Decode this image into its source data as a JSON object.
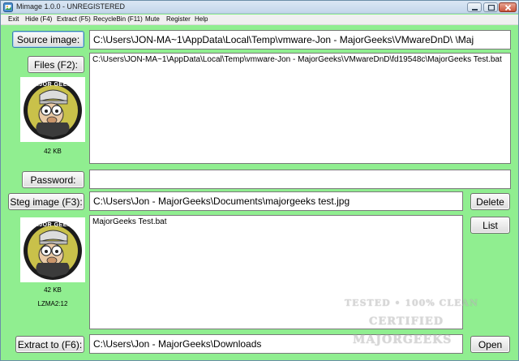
{
  "window": {
    "title": "Mimage 1.0.0 - UNREGISTERED"
  },
  "menu": [
    "Exit",
    "Hide (F4)",
    "Extract (F5)",
    "RecycleBin (F11)",
    "Mute",
    "Register",
    "Help"
  ],
  "source": {
    "button_label": "Source image:",
    "path": "C:\\Users\\JON-MA~1\\AppData\\Local\\Temp\\vmware-Jon - MajorGeeks\\VMwareDnD\\        \\Maj"
  },
  "files": {
    "button_label": "Files (F2):",
    "content": "C:\\Users\\JON-MA~1\\AppData\\Local\\Temp\\vmware-Jon - MajorGeeks\\VMwareDnD\\fd19548c\\MajorGeeks Test.bat",
    "thumb_size": "42 KB"
  },
  "password": {
    "button_label": "Password:",
    "value": ""
  },
  "steg": {
    "button_label": "Steg image (F3):",
    "path": "C:\\Users\\Jon - MajorGeeks\\Documents\\majorgeeks test.jpg",
    "delete_label": "Delete",
    "list_label": "List",
    "content": "MajorGeeks Test.bat",
    "thumb_size": "42 KB",
    "compression": "LZMA2:12"
  },
  "extract": {
    "button_label": "Extract to (F6):",
    "path": "C:\\Users\\Jon - MajorGeeks\\Downloads",
    "open_label": "Open"
  },
  "logo_text": "MAJOR GEEKS",
  "watermark": {
    "line1": "TESTED • 100% CLEAN",
    "line2": "CERTIFIED",
    "line3": "MAJORGEEKS"
  },
  "colors": {
    "background": "#90ee90",
    "field_bg": "#ffffff"
  }
}
